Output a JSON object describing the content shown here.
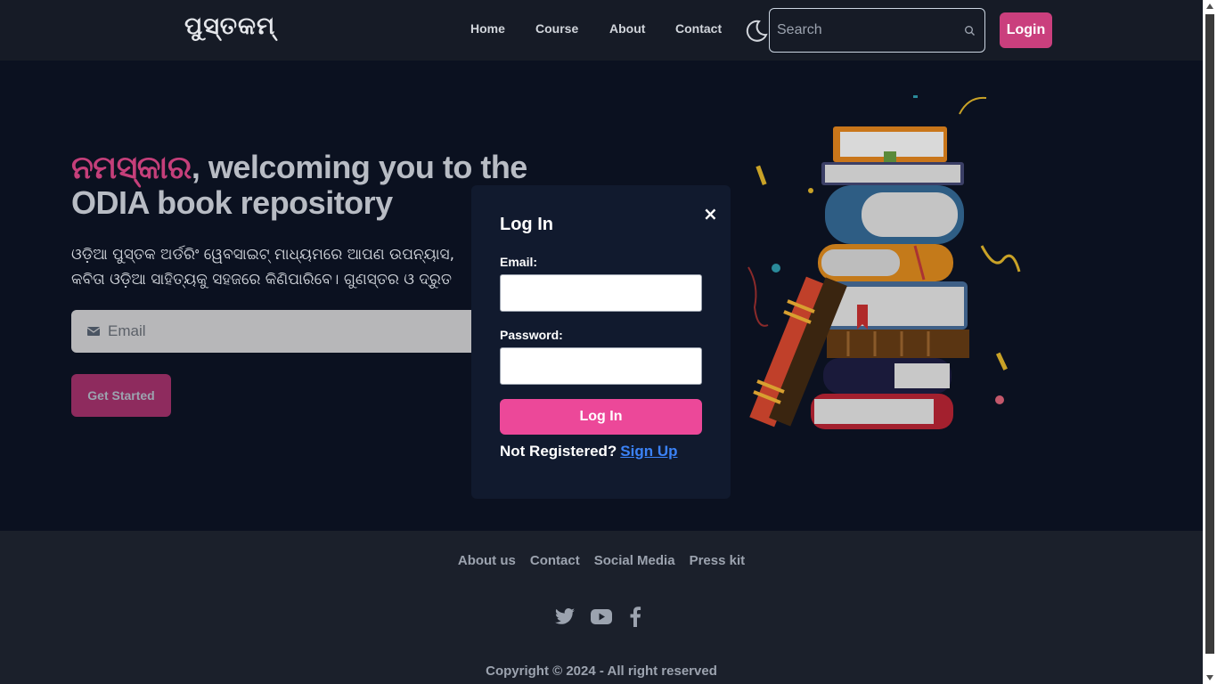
{
  "navbar": {
    "logo": "ପୁସ୍ତକମ୍",
    "links": [
      "Home",
      "Course",
      "About",
      "Contact"
    ],
    "search_placeholder": "Search",
    "login_label": "Login"
  },
  "hero": {
    "title_accent": "ନମସ୍କାର",
    "title_rest": ", welcoming you to the ODIA book repository",
    "description": "ଓଡ଼ିଆ ପୁସ୍ତକ ଅର୍ଡରିଂ ୱେବସାଇଟ୍ ମାଧ୍ୟମରେ ଆପଣ ଉପନ୍ୟାସ, କବିତା ଓଡ଼ିଆ ସାହିତ୍ୟକୁ ସହଜରେ କିଣିପାରିବେ। ଗୁଣସ୍ତର ଓ ଦ୍ରୁତ ବିତରଣ।",
    "email_placeholder": "Email",
    "cta_label": "Get Started"
  },
  "modal": {
    "title": "Log In",
    "close_glyph": "×",
    "email_label": "Email:",
    "password_label": "Password:",
    "submit_label": "Log In",
    "register_prompt": "Not Registered?",
    "signup_label": "Sign Up"
  },
  "footer": {
    "links": [
      "About us",
      "Contact",
      "Social Media",
      "Press kit"
    ],
    "social_icons": [
      "twitter-icon",
      "youtube-icon",
      "facebook-icon"
    ],
    "copyright": "Copyright © 2024 - All right reserved"
  },
  "colors": {
    "accent": "#ec4899",
    "background": "#0b1120",
    "navbar": "#161b26",
    "footer": "#1b202b"
  }
}
